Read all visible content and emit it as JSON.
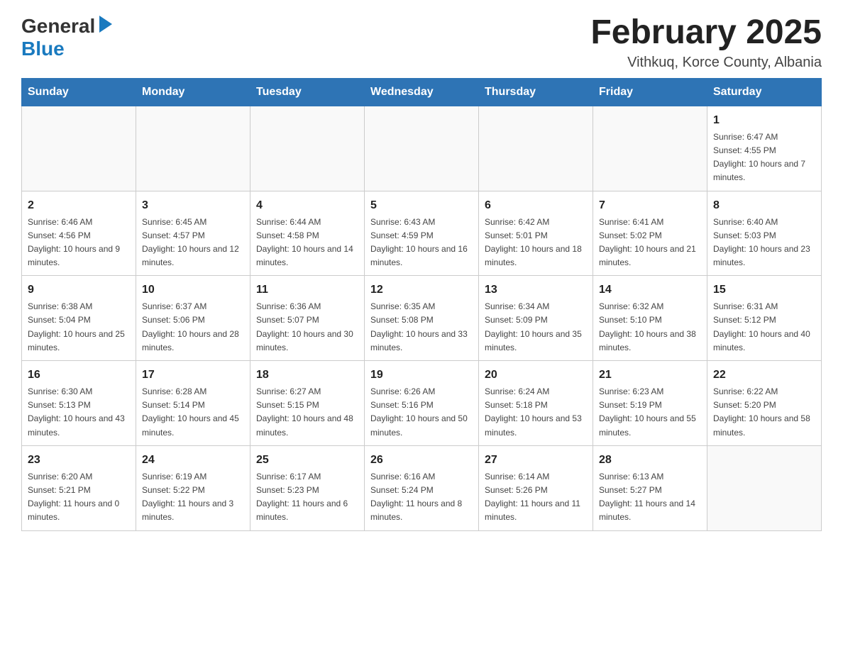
{
  "header": {
    "logo": {
      "general": "General",
      "blue": "Blue",
      "tagline": ""
    },
    "title": "February 2025",
    "subtitle": "Vithkuq, Korce County, Albania"
  },
  "days_of_week": [
    "Sunday",
    "Monday",
    "Tuesday",
    "Wednesday",
    "Thursday",
    "Friday",
    "Saturday"
  ],
  "weeks": [
    {
      "days": [
        {
          "number": "",
          "info": ""
        },
        {
          "number": "",
          "info": ""
        },
        {
          "number": "",
          "info": ""
        },
        {
          "number": "",
          "info": ""
        },
        {
          "number": "",
          "info": ""
        },
        {
          "number": "",
          "info": ""
        },
        {
          "number": "1",
          "info": "Sunrise: 6:47 AM\nSunset: 4:55 PM\nDaylight: 10 hours and 7 minutes."
        }
      ]
    },
    {
      "days": [
        {
          "number": "2",
          "info": "Sunrise: 6:46 AM\nSunset: 4:56 PM\nDaylight: 10 hours and 9 minutes."
        },
        {
          "number": "3",
          "info": "Sunrise: 6:45 AM\nSunset: 4:57 PM\nDaylight: 10 hours and 12 minutes."
        },
        {
          "number": "4",
          "info": "Sunrise: 6:44 AM\nSunset: 4:58 PM\nDaylight: 10 hours and 14 minutes."
        },
        {
          "number": "5",
          "info": "Sunrise: 6:43 AM\nSunset: 4:59 PM\nDaylight: 10 hours and 16 minutes."
        },
        {
          "number": "6",
          "info": "Sunrise: 6:42 AM\nSunset: 5:01 PM\nDaylight: 10 hours and 18 minutes."
        },
        {
          "number": "7",
          "info": "Sunrise: 6:41 AM\nSunset: 5:02 PM\nDaylight: 10 hours and 21 minutes."
        },
        {
          "number": "8",
          "info": "Sunrise: 6:40 AM\nSunset: 5:03 PM\nDaylight: 10 hours and 23 minutes."
        }
      ]
    },
    {
      "days": [
        {
          "number": "9",
          "info": "Sunrise: 6:38 AM\nSunset: 5:04 PM\nDaylight: 10 hours and 25 minutes."
        },
        {
          "number": "10",
          "info": "Sunrise: 6:37 AM\nSunset: 5:06 PM\nDaylight: 10 hours and 28 minutes."
        },
        {
          "number": "11",
          "info": "Sunrise: 6:36 AM\nSunset: 5:07 PM\nDaylight: 10 hours and 30 minutes."
        },
        {
          "number": "12",
          "info": "Sunrise: 6:35 AM\nSunset: 5:08 PM\nDaylight: 10 hours and 33 minutes."
        },
        {
          "number": "13",
          "info": "Sunrise: 6:34 AM\nSunset: 5:09 PM\nDaylight: 10 hours and 35 minutes."
        },
        {
          "number": "14",
          "info": "Sunrise: 6:32 AM\nSunset: 5:10 PM\nDaylight: 10 hours and 38 minutes."
        },
        {
          "number": "15",
          "info": "Sunrise: 6:31 AM\nSunset: 5:12 PM\nDaylight: 10 hours and 40 minutes."
        }
      ]
    },
    {
      "days": [
        {
          "number": "16",
          "info": "Sunrise: 6:30 AM\nSunset: 5:13 PM\nDaylight: 10 hours and 43 minutes."
        },
        {
          "number": "17",
          "info": "Sunrise: 6:28 AM\nSunset: 5:14 PM\nDaylight: 10 hours and 45 minutes."
        },
        {
          "number": "18",
          "info": "Sunrise: 6:27 AM\nSunset: 5:15 PM\nDaylight: 10 hours and 48 minutes."
        },
        {
          "number": "19",
          "info": "Sunrise: 6:26 AM\nSunset: 5:16 PM\nDaylight: 10 hours and 50 minutes."
        },
        {
          "number": "20",
          "info": "Sunrise: 6:24 AM\nSunset: 5:18 PM\nDaylight: 10 hours and 53 minutes."
        },
        {
          "number": "21",
          "info": "Sunrise: 6:23 AM\nSunset: 5:19 PM\nDaylight: 10 hours and 55 minutes."
        },
        {
          "number": "22",
          "info": "Sunrise: 6:22 AM\nSunset: 5:20 PM\nDaylight: 10 hours and 58 minutes."
        }
      ]
    },
    {
      "days": [
        {
          "number": "23",
          "info": "Sunrise: 6:20 AM\nSunset: 5:21 PM\nDaylight: 11 hours and 0 minutes."
        },
        {
          "number": "24",
          "info": "Sunrise: 6:19 AM\nSunset: 5:22 PM\nDaylight: 11 hours and 3 minutes."
        },
        {
          "number": "25",
          "info": "Sunrise: 6:17 AM\nSunset: 5:23 PM\nDaylight: 11 hours and 6 minutes."
        },
        {
          "number": "26",
          "info": "Sunrise: 6:16 AM\nSunset: 5:24 PM\nDaylight: 11 hours and 8 minutes."
        },
        {
          "number": "27",
          "info": "Sunrise: 6:14 AM\nSunset: 5:26 PM\nDaylight: 11 hours and 11 minutes."
        },
        {
          "number": "28",
          "info": "Sunrise: 6:13 AM\nSunset: 5:27 PM\nDaylight: 11 hours and 14 minutes."
        },
        {
          "number": "",
          "info": ""
        }
      ]
    }
  ]
}
